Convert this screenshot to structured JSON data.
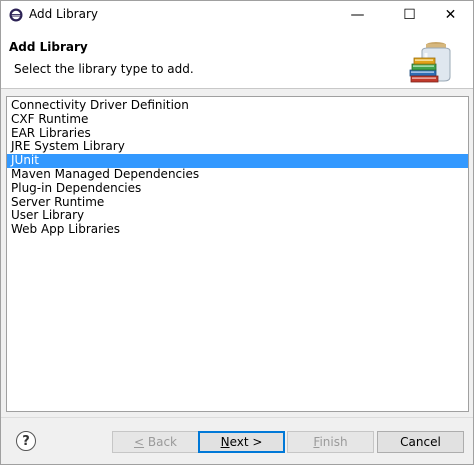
{
  "window": {
    "title": "Add Library",
    "minimize_symbol": "—",
    "maximize_symbol": "☐",
    "close_symbol": "✕"
  },
  "header": {
    "title": "Add Library",
    "description": "Select the library type to add."
  },
  "library_types": [
    {
      "label": "Connectivity Driver Definition"
    },
    {
      "label": "CXF Runtime"
    },
    {
      "label": "EAR Libraries"
    },
    {
      "label": "JRE System Library"
    },
    {
      "label": "JUnit",
      "selected": true
    },
    {
      "label": "Maven Managed Dependencies"
    },
    {
      "label": "Plug-in Dependencies"
    },
    {
      "label": "Server Runtime"
    },
    {
      "label": "User Library"
    },
    {
      "label": "Web App Libraries"
    }
  ],
  "footer": {
    "help_symbol": "?",
    "back_label": "< Back",
    "next_label": "Next >",
    "finish_label": "Finish",
    "cancel_label": "Cancel"
  },
  "colors": {
    "selection": "#3399ff",
    "primary_border": "#0078d7"
  }
}
